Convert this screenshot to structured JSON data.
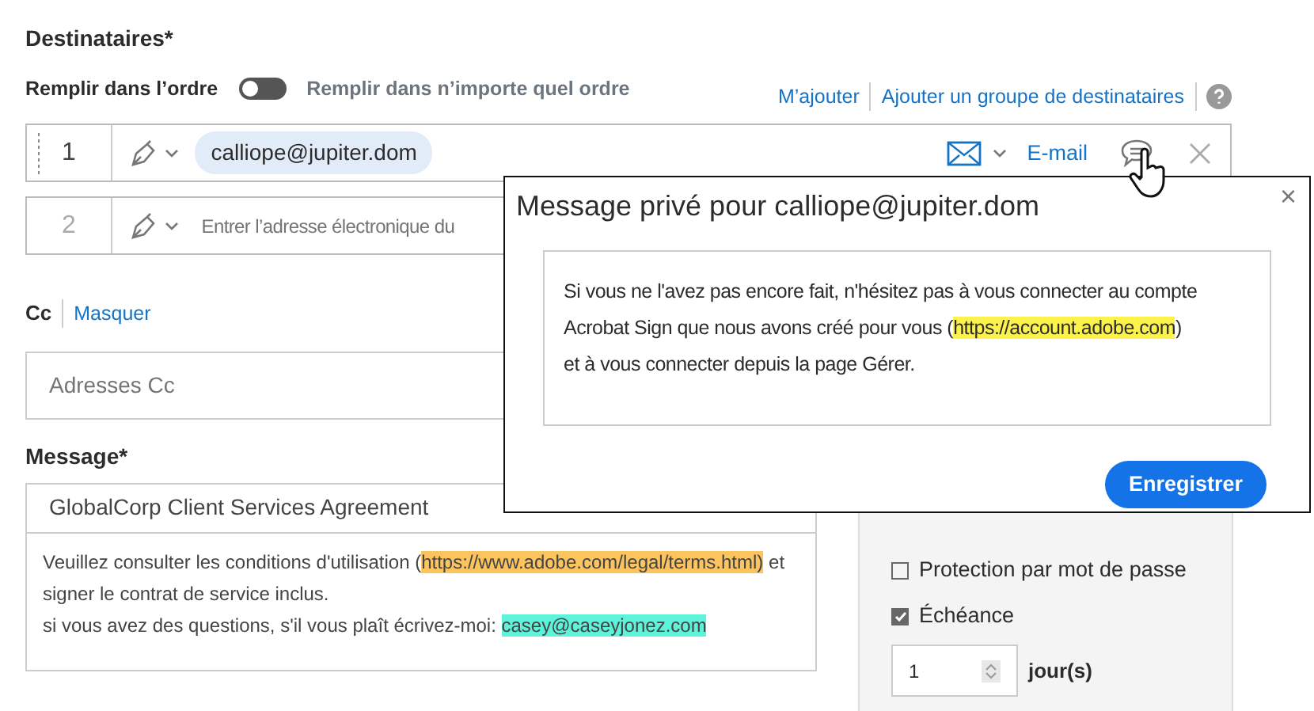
{
  "recipients_section": {
    "title": "Destinataires",
    "required_mark": "*",
    "order_label": "Remplir dans l’ordre",
    "order_toggle": {
      "on": false
    },
    "any_order_label": "Remplir dans n’importe quel ordre",
    "links": [
      "M’ajouter",
      "Ajouter un groupe de destinataires"
    ]
  },
  "recipients": [
    {
      "number": "1",
      "email": "calliope@jupiter.dom",
      "delivery": "E-mail"
    },
    {
      "number": "2",
      "placeholder": "Entrer l’adresse électronique du"
    }
  ],
  "cc": {
    "label": "Cc",
    "toggle_link": "Masquer",
    "placeholder": "Adresses Cc"
  },
  "message": {
    "title": "Message",
    "required_mark": "*",
    "subject": "GlobalCorp Client Services Agreement",
    "body_lines": [
      [
        {
          "text": "Veuillez consulter les conditions d'utilisation ("
        },
        {
          "text": "https://www.adobe.com/legal/terms.html)",
          "color": "#fcc45f"
        },
        {
          "text": " et"
        }
      ],
      [
        {
          "text": "signer le contrat de service inclus."
        }
      ],
      [
        {
          "text": "si vous avez des questions, s'il vous plaît écrivez-moi: "
        },
        {
          "text": "casey@caseyjonez.com",
          "color": "#5ef2da"
        }
      ]
    ]
  },
  "options": {
    "items": [
      {
        "kind": "checkbox",
        "label": "Protection par mot de passe",
        "checked": false
      },
      {
        "kind": "checkbox",
        "label": "Échéance",
        "checked": true
      },
      {
        "kind": "spinner",
        "value": "1",
        "unit": "jour(s)"
      }
    ]
  },
  "private_message_dialog": {
    "title": "Message privé pour calliope@jupiter.dom",
    "close": "×",
    "body_lines": [
      [
        {
          "text": "Si vous ne l'avez pas encore fait, n'hésitez pas à vous connecter au compte"
        }
      ],
      [
        {
          "text": "Acrobat Sign que nous avons créé pour vous ("
        },
        {
          "text": "https://account.adobe.com",
          "color": "#fbf24b"
        },
        {
          "text": ")"
        }
      ],
      [
        {
          "text": "et à vous connecter depuis la page Gérer."
        }
      ]
    ],
    "save_button": "Enregistrer"
  }
}
